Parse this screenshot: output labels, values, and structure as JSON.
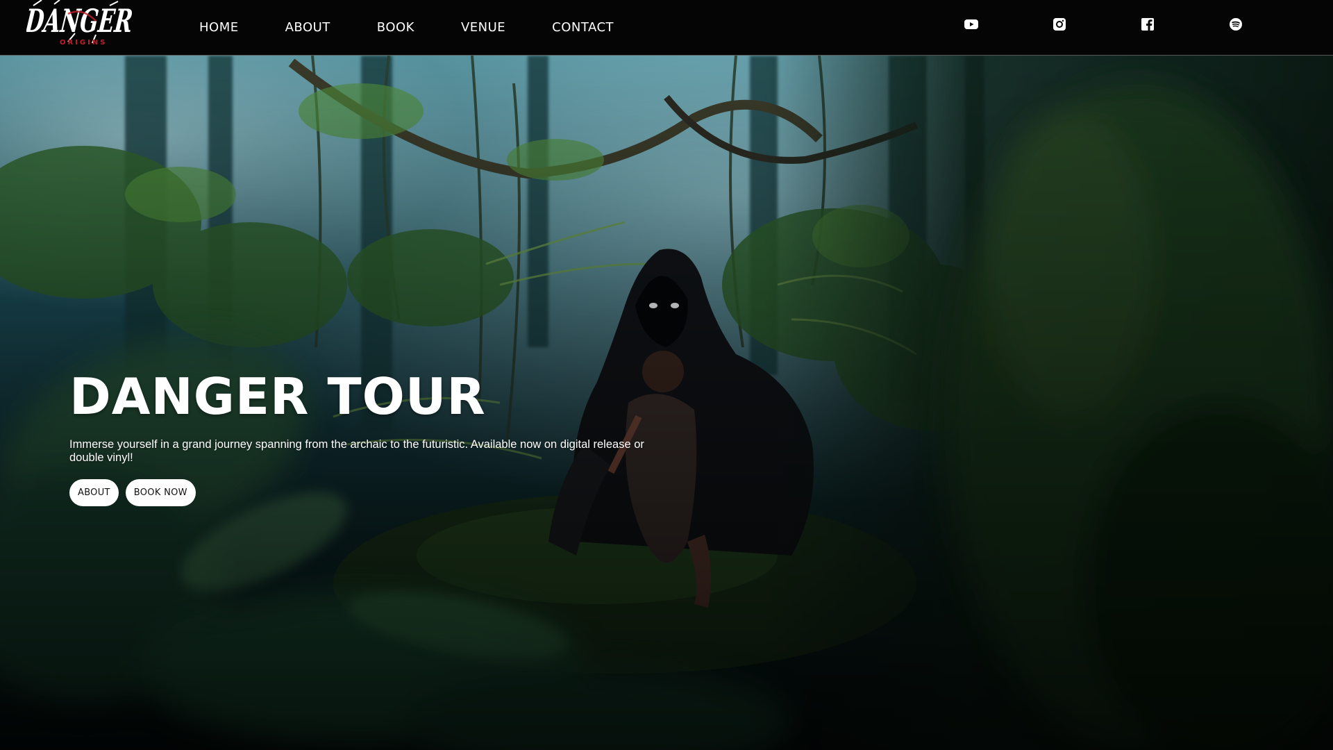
{
  "brand": {
    "logo_text": "DANGER",
    "logo_subtext": "ORIGINS",
    "colors": {
      "logo_white": "#ffffff",
      "logo_red": "#c0202a",
      "header_bg": "#050505"
    }
  },
  "nav": {
    "items": [
      {
        "label": "HOME"
      },
      {
        "label": "ABOUT"
      },
      {
        "label": "BOOK"
      },
      {
        "label": "VENUE"
      },
      {
        "label": "CONTACT"
      }
    ]
  },
  "social": [
    {
      "icon": "youtube-icon"
    },
    {
      "icon": "instagram-icon"
    },
    {
      "icon": "facebook-icon"
    },
    {
      "icon": "spotify-icon"
    }
  ],
  "hero": {
    "title": "DANGER TOUR",
    "description": "Immerse yourself in a grand journey spanning from the archaic to the futuristic. Available now on digital release or double vinyl!",
    "buttons": {
      "about": "ABOUT",
      "book_now": "BOOK NOW"
    },
    "colors": {
      "forest_dark": "#0a1a1a",
      "forest_teal": "#1f5a66",
      "foliage": "#2f6b2a"
    }
  }
}
